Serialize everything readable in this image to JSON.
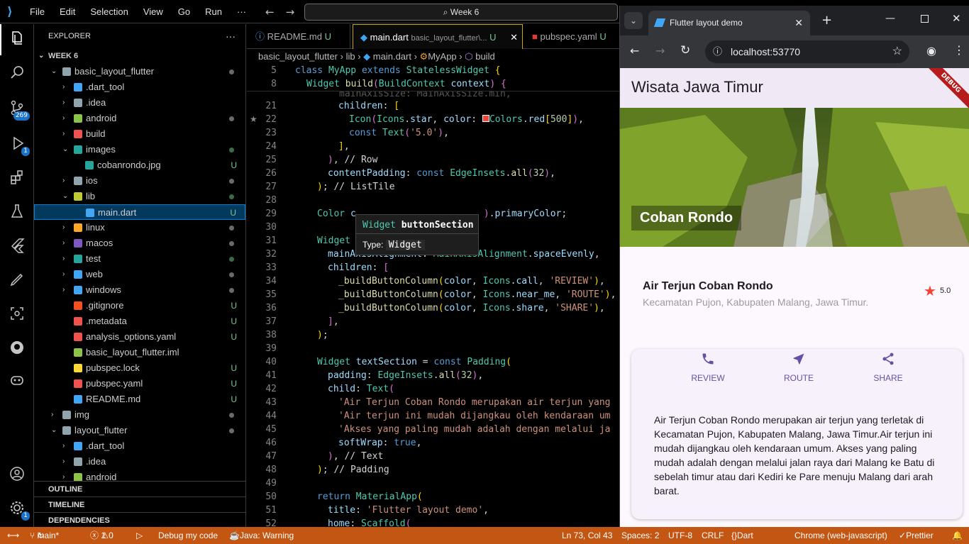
{
  "vscode": {
    "menu": [
      "File",
      "Edit",
      "Selection",
      "View",
      "Go",
      "Run",
      "···"
    ],
    "command_center": "Week 6",
    "explorer_title": "EXPLORER",
    "badge_scm": "269",
    "badge_debug": "1",
    "badge_settings": "1",
    "root": "WEEK 6",
    "tree": [
      {
        "label": "basic_layout_flutter",
        "status": "dot"
      },
      {
        "label": ".dart_tool",
        "status": ""
      },
      {
        "label": ".idea",
        "status": ""
      },
      {
        "label": "android",
        "status": "dot"
      },
      {
        "label": "build",
        "status": ""
      },
      {
        "label": "images",
        "status": "gdot"
      },
      {
        "label": "cobanrondo.jpg",
        "status": "U"
      },
      {
        "label": "ios",
        "status": "dot"
      },
      {
        "label": "lib",
        "status": "gdot"
      },
      {
        "label": "main.dart",
        "status": "U"
      },
      {
        "label": "linux",
        "status": "dot"
      },
      {
        "label": "macos",
        "status": "dot"
      },
      {
        "label": "test",
        "status": "gdot"
      },
      {
        "label": "web",
        "status": "dot"
      },
      {
        "label": "windows",
        "status": "dot"
      },
      {
        "label": ".gitignore",
        "status": "U"
      },
      {
        "label": ".metadata",
        "status": "U"
      },
      {
        "label": "analysis_options.yaml",
        "status": "U"
      },
      {
        "label": "basic_layout_flutter.iml",
        "status": ""
      },
      {
        "label": "pubspec.lock",
        "status": "U"
      },
      {
        "label": "pubspec.yaml",
        "status": "U"
      },
      {
        "label": "README.md",
        "status": "U"
      },
      {
        "label": "img",
        "status": "dot"
      },
      {
        "label": "layout_flutter",
        "status": "dot"
      },
      {
        "label": ".dart_tool",
        "status": ""
      },
      {
        "label": ".idea",
        "status": ""
      },
      {
        "label": "android",
        "status": ""
      }
    ],
    "sections": [
      "OUTLINE",
      "TIMELINE",
      "DEPENDENCIES"
    ],
    "tabs": [
      {
        "name": "README.md",
        "status": "U"
      },
      {
        "name": "main.dart",
        "path": "basic_layout_flutter\\...",
        "status": "U"
      },
      {
        "name": "pubspec.yaml",
        "status": "U"
      }
    ],
    "breadcrumbs": [
      "basic_layout_flutter",
      "lib",
      "main.dart",
      "MyApp",
      "build"
    ],
    "hover": {
      "title_kw": "Widget",
      "title_name": "buttonSection",
      "type_label": "Type:",
      "type_value": "Widget"
    },
    "status": {
      "branch": "main*",
      "problems": "1",
      "warnings": "0",
      "debug": "Debug my code",
      "java": "Java: Warning",
      "position": "Ln 73, Col 43",
      "spaces": "Spaces: 2",
      "encoding": "UTF-8",
      "eol": "CRLF",
      "language": "Dart",
      "device": "Chrome (web-javascript)",
      "formatter": "Prettier"
    }
  },
  "browser": {
    "tab_title": "Flutter layout demo",
    "url": "localhost:53770",
    "app_title": "Wisata Jawa Timur",
    "debug_banner": "DEBUG",
    "hero_caption": "Coban Rondo",
    "place_title": "Air Terjun Coban Rondo",
    "place_subtitle": "Kecamatan Pujon, Kabupaten Malang, Jawa Timur.",
    "rating": "5.0",
    "buttons": [
      "REVIEW",
      "ROUTE",
      "SHARE"
    ],
    "description": "Air Terjun Coban Rondo merupakan air terjun yang terletak di Kecamatan Pujon, Kabupaten Malang, Jawa Timur.Air terjun ini mudah dijangkau oleh kendaraan umum. Akses yang paling mudah adalah dengan melalui jalan raya dari Malang ke Batu di sebelah timur atau dari Kediri ke Pare menuju Malang dari arah barat."
  },
  "colors": {
    "accent": "#6750a4",
    "statusbar": "#c25612",
    "star": "#f44336"
  }
}
